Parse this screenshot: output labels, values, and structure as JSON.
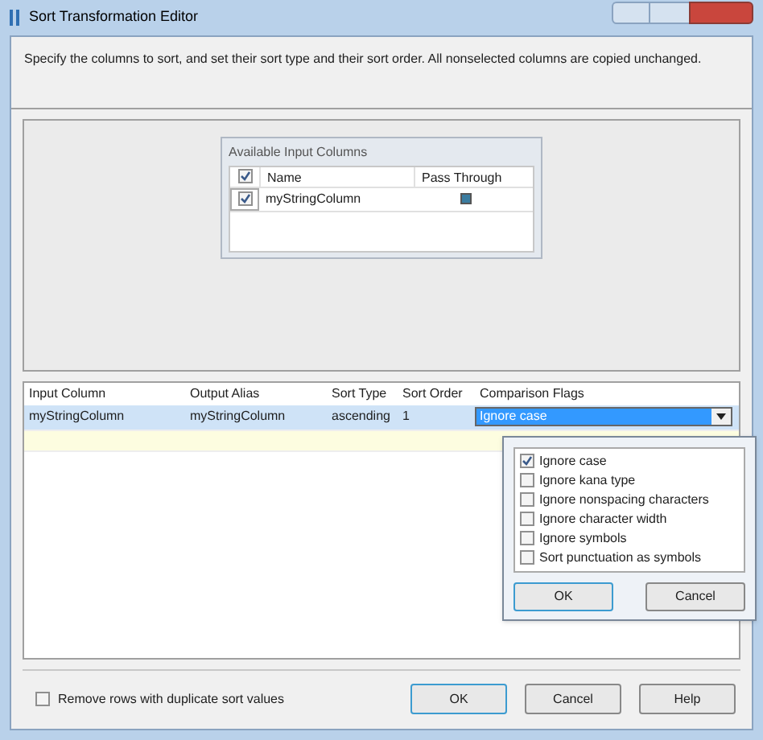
{
  "window": {
    "title": "Sort Transformation Editor"
  },
  "description": "Specify the columns to sort, and set their sort type and their sort order. All nonselected columns are copied unchanged.",
  "available_columns": {
    "title": "Available Input Columns",
    "header": {
      "checked": true,
      "columns": [
        "Name",
        "Pass Through"
      ]
    },
    "rows": [
      {
        "checked": true,
        "name": "myStringColumn",
        "pass_through": true
      }
    ]
  },
  "grid": {
    "columns": [
      "Input Column",
      "Output Alias",
      "Sort Type",
      "Sort Order",
      "Comparison Flags"
    ],
    "rows": [
      {
        "selected": true,
        "cells": [
          "myStringColumn",
          "myStringColumn",
          "ascending",
          "1"
        ],
        "flags": "Ignore case"
      }
    ]
  },
  "flags_popup": {
    "options": [
      {
        "label": "Ignore case",
        "checked": true
      },
      {
        "label": "Ignore kana type",
        "checked": false
      },
      {
        "label": "Ignore nonspacing characters",
        "checked": false
      },
      {
        "label": "Ignore character width",
        "checked": false
      },
      {
        "label": "Ignore symbols",
        "checked": false
      },
      {
        "label": "Sort punctuation as symbols",
        "checked": false
      }
    ],
    "buttons": [
      "OK",
      "Cancel"
    ]
  },
  "remove_duplicates": {
    "label": "Remove rows with duplicate sort values",
    "checked": false
  },
  "buttons": [
    "OK",
    "Cancel",
    "Help"
  ]
}
